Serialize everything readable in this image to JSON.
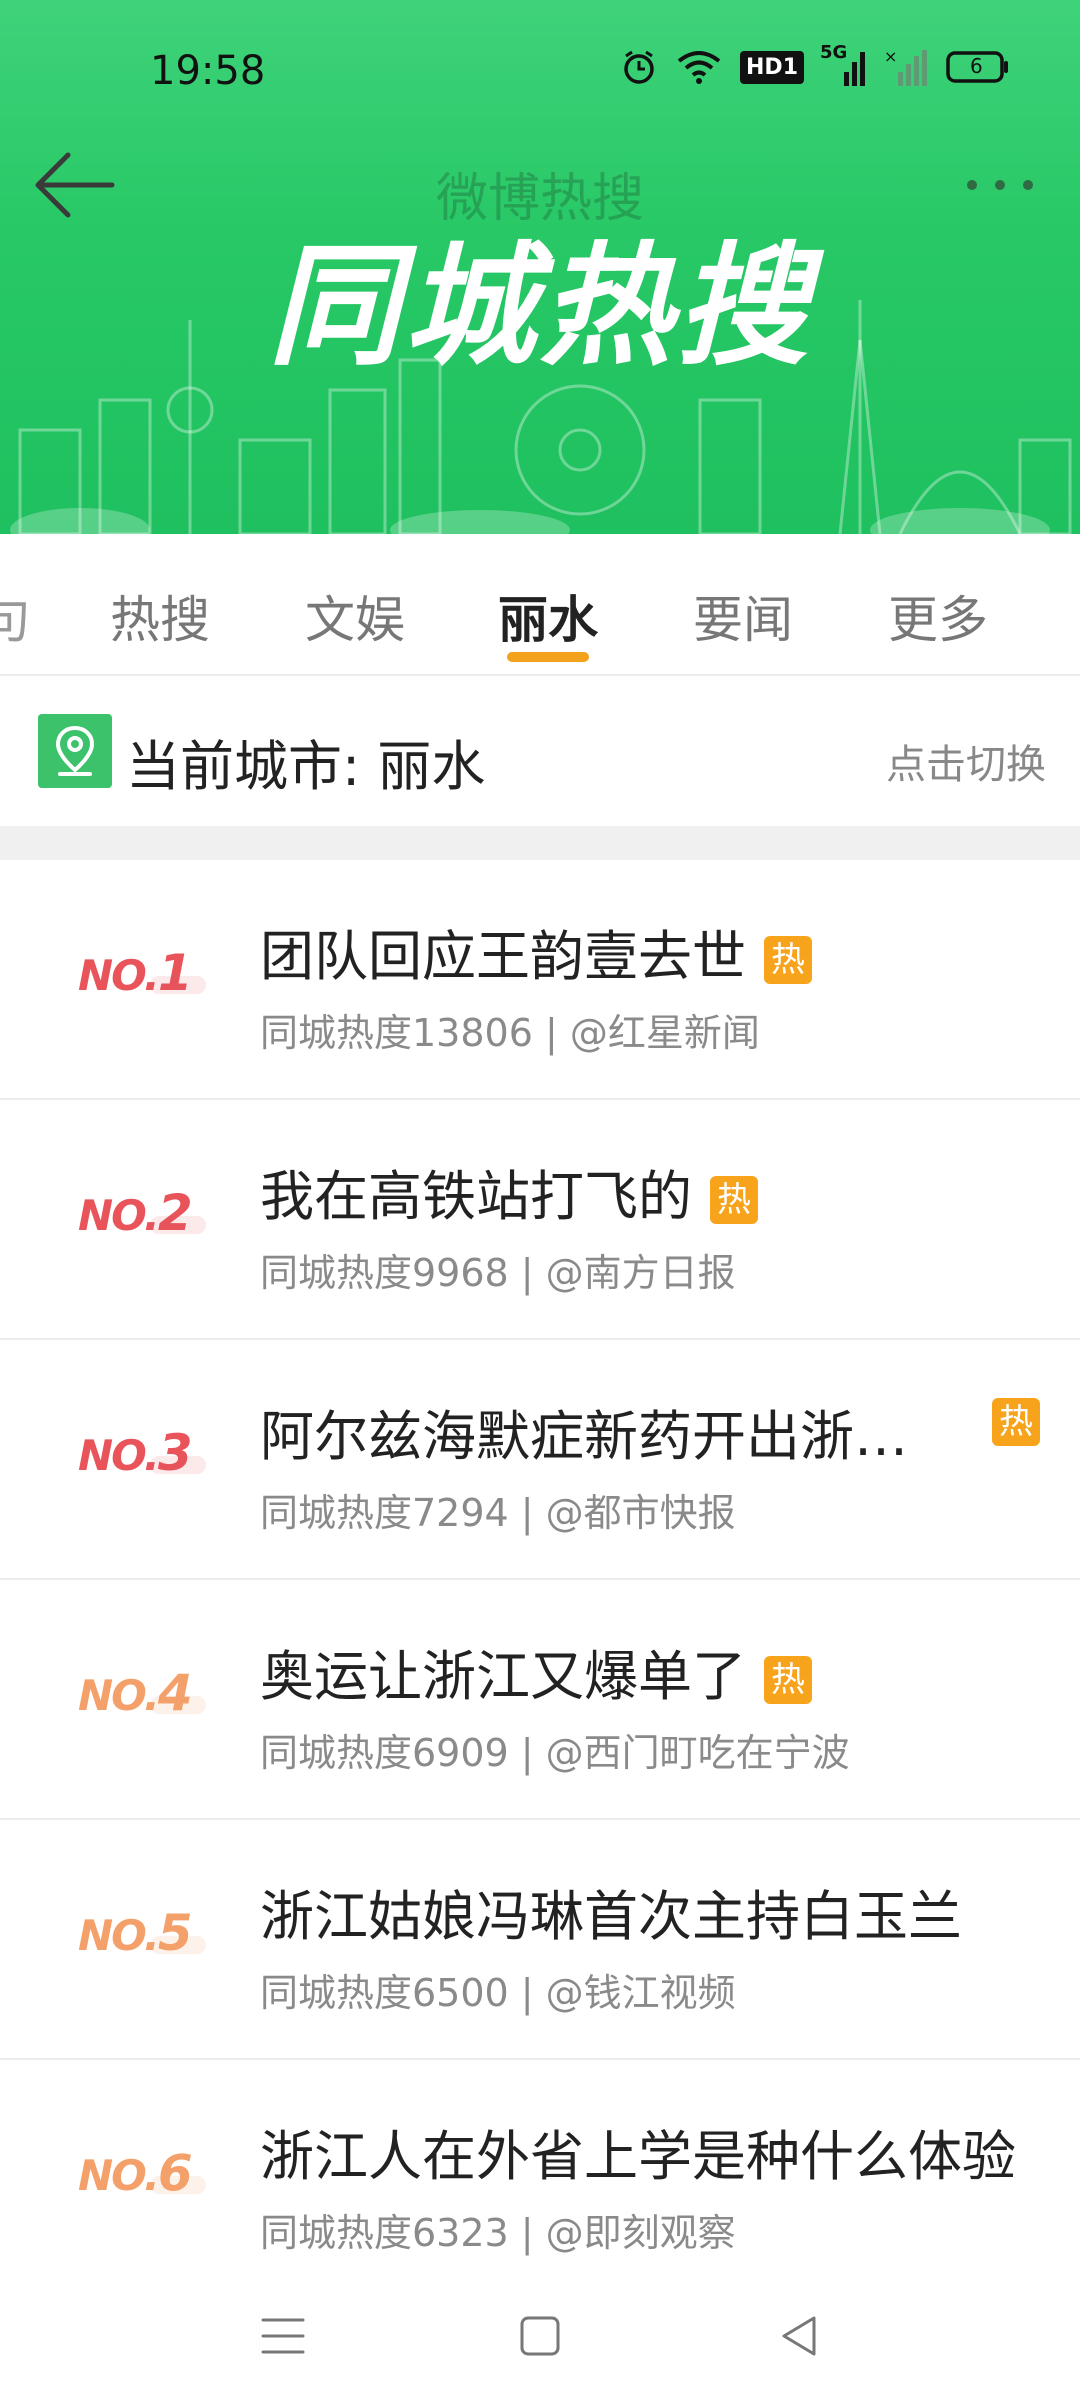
{
  "status_bar": {
    "time": "19:58",
    "hd_label": "HD1",
    "signal_label": "5G",
    "battery": "6"
  },
  "header": {
    "nav_title": "微博热搜",
    "banner_title": "同城热搜",
    "brand_color": "#27c865"
  },
  "tabs": [
    {
      "label": "热搜"
    },
    {
      "label": "文娱"
    },
    {
      "label": "丽水",
      "active": true
    },
    {
      "label": "要闻"
    },
    {
      "label": "更多"
    }
  ],
  "city": {
    "label": "当前城市: 丽水",
    "switch_label": "点击切换"
  },
  "hot_badge": "热",
  "list": [
    {
      "rank_no": "NO.",
      "rank": "1",
      "title": "团队回应王韵壹去世",
      "meta": "同城热度13806 | @红星新闻",
      "hot": true
    },
    {
      "rank_no": "NO.",
      "rank": "2",
      "title": "我在高铁站打飞的",
      "meta": "同城热度9968 | @南方日报",
      "hot": true
    },
    {
      "rank_no": "NO.",
      "rank": "3",
      "title": "阿尔兹海默症新药开出浙江...",
      "meta": "同城热度7294 | @都市快报",
      "hot": true
    },
    {
      "rank_no": "NO.",
      "rank": "4",
      "title": "奥运让浙江又爆单了",
      "meta": "同城热度6909 | @西门町吃在宁波",
      "hot": true
    },
    {
      "rank_no": "NO.",
      "rank": "5",
      "title": "浙江姑娘冯琳首次主持白玉兰",
      "meta": "同城热度6500 | @钱江视频",
      "hot": false
    },
    {
      "rank_no": "NO.",
      "rank": "6",
      "title": "浙江人在外省上学是种什么体验",
      "meta": "同城热度6323 | @即刻观察",
      "hot": false
    }
  ],
  "colors": {
    "accent": "#f3a21b",
    "rank_top": "#e8545a",
    "rank_mid": "#f4a06a"
  }
}
